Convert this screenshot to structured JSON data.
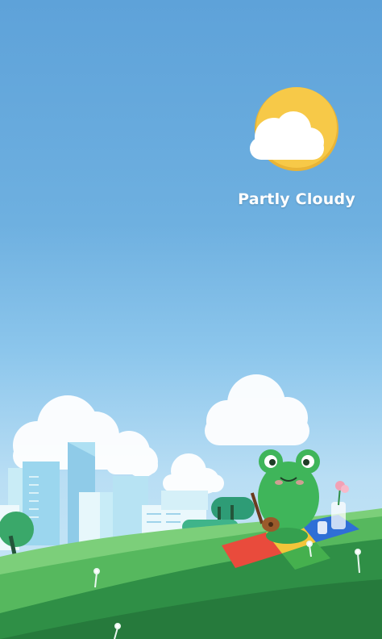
{
  "weather": {
    "condition": "Partly Cloudy",
    "icon": "partly-cloudy-icon"
  },
  "illustration": {
    "character": "frog-with-ukulele",
    "colors": {
      "sun": "#f7c948",
      "frog": "#3fb55a",
      "grass": "#2f8f46",
      "blanket_red": "#e94b3c",
      "blanket_yellow": "#f3c53a",
      "blanket_green": "#45b04e",
      "blanket_blue": "#2f6fd6"
    }
  }
}
